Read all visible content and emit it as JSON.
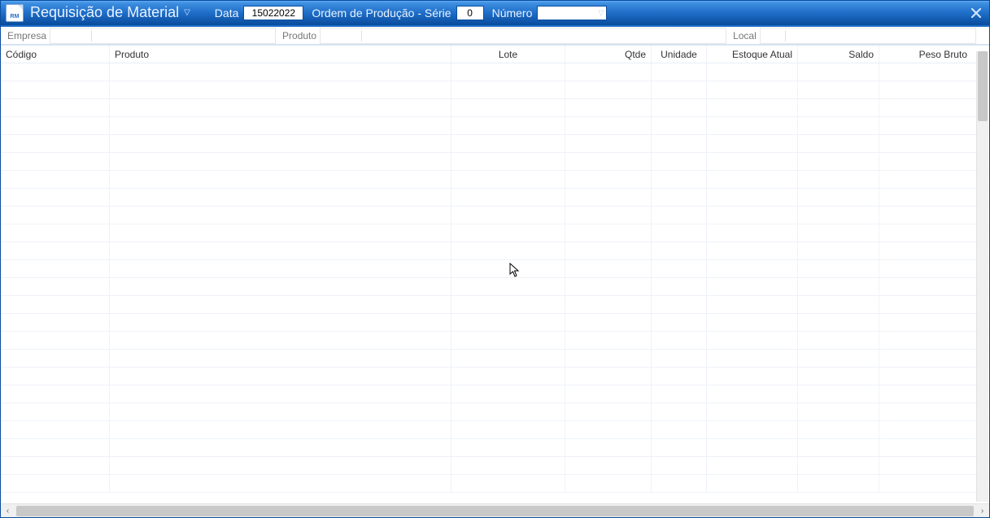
{
  "titlebar": {
    "icon_label": "RM",
    "title": "Requisição de Material",
    "data_label": "Data",
    "data_value": "15022022",
    "ordem_label": "Ordem de Produção - Série",
    "serie_value": "0",
    "numero_label": "Número",
    "numero_value": ""
  },
  "subheader": {
    "empresa_label": "Empresa",
    "empresa_value": "",
    "produto_label": "Produto",
    "produto_value": "",
    "local_label": "Local",
    "local_value": ""
  },
  "columns": {
    "codigo": "Código",
    "produto": "Produto",
    "lote": "Lote",
    "qtde": "Qtde",
    "unidade": "Unidade",
    "estoque": "Estoque Atual",
    "saldo": "Saldo",
    "peso": "Peso Bruto"
  },
  "rows": []
}
